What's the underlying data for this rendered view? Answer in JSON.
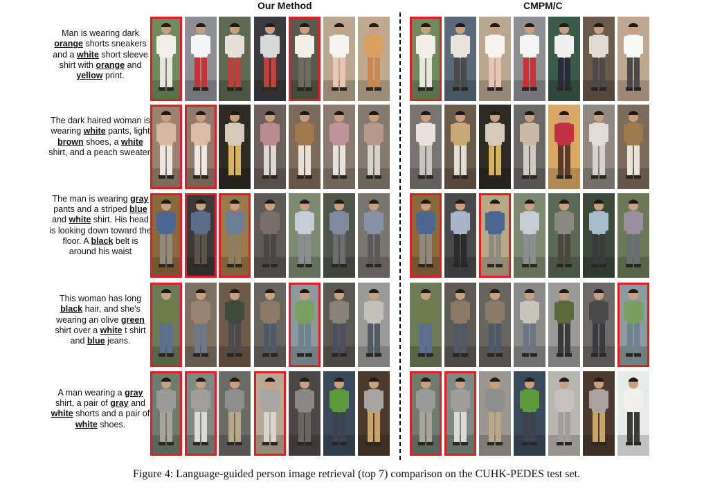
{
  "headers": {
    "left": "Our Method",
    "right": "CMPM/C"
  },
  "queries": [
    {
      "segments": [
        [
          "Man is wearing dark ",
          0
        ],
        [
          "orange",
          1
        ],
        [
          " shorts sneakers and a ",
          0
        ],
        [
          "white",
          1
        ],
        [
          " short sleeve shirt with ",
          0
        ],
        [
          "orange",
          1
        ],
        [
          " and ",
          0
        ],
        [
          "yellow",
          1
        ],
        [
          " print.",
          0
        ]
      ]
    },
    {
      "segments": [
        [
          "The dark haired woman is wearing ",
          0
        ],
        [
          "white",
          1
        ],
        [
          " pants,  light ",
          0
        ],
        [
          "brown",
          1
        ],
        [
          " shoes, a ",
          0
        ],
        [
          "white",
          1
        ],
        [
          " shirt, and a peach sweater.",
          0
        ]
      ]
    },
    {
      "segments": [
        [
          "The man is wearing ",
          0
        ],
        [
          "gray",
          1
        ],
        [
          " pants and a striped ",
          0
        ],
        [
          "blue",
          1
        ],
        [
          " and ",
          0
        ],
        [
          "white",
          1
        ],
        [
          " shirt. His head is looking down toward the floor. A ",
          0
        ],
        [
          "black",
          1
        ],
        [
          " belt is around his waist",
          0
        ]
      ]
    },
    {
      "segments": [
        [
          "This woman has long ",
          0
        ],
        [
          "black",
          1
        ],
        [
          " hair, and she's wearing an olive ",
          0
        ],
        [
          "green",
          1
        ],
        [
          " shirt over a ",
          0
        ],
        [
          "white",
          1
        ],
        [
          " t shirt and ",
          0
        ],
        [
          "blue",
          1
        ],
        [
          " jeans.",
          0
        ]
      ]
    },
    {
      "segments": [
        [
          "A man wearing a ",
          0
        ],
        [
          "gray",
          1
        ],
        [
          " shirt, a pair of ",
          0
        ],
        [
          "gray",
          1
        ],
        [
          " and ",
          0
        ],
        [
          "white",
          1
        ],
        [
          " shorts and a pair of ",
          0
        ],
        [
          "white",
          1
        ],
        [
          " shoes.",
          0
        ]
      ]
    }
  ],
  "results": {
    "ours": [
      [
        {
          "m": 1,
          "bg": "#6f8a5c",
          "top": "#f2efe8",
          "bot": "#e9e6df"
        },
        {
          "m": 0,
          "bg": "#8d8f93",
          "top": "#f5f5f5",
          "bot": "#c9313a"
        },
        {
          "m": 0,
          "bg": "#5e6a52",
          "top": "#e6e0d8",
          "bot": "#c23c3c"
        },
        {
          "m": 0,
          "bg": "#3b3b3f",
          "top": "#d8d8d8",
          "bot": "#c0403a"
        },
        {
          "m": 1,
          "bg": "#5a5a4c",
          "top": "#f3f0ea",
          "bot": "#6b6b60"
        },
        {
          "m": 0,
          "bg": "#b9a790",
          "top": "#f7f4ef",
          "bot": "#e8c6b5"
        },
        {
          "m": 0,
          "bg": "#c0ab92",
          "top": "#d9a060",
          "bot": "#c88850"
        }
      ],
      [
        {
          "m": 1,
          "bg": "#9a8470",
          "top": "#d9b8a2",
          "bot": "#ebe8e2"
        },
        {
          "m": 1,
          "bg": "#8e7b69",
          "top": "#dbbca5",
          "bot": "#ebe8e2"
        },
        {
          "m": 0,
          "bg": "#2e2a24",
          "top": "#d5c9b8",
          "bot": "#d9b25c"
        },
        {
          "m": 0,
          "bg": "#6b615a",
          "top": "#b98d8f",
          "bot": "#dcd8d2"
        },
        {
          "m": 0,
          "bg": "#7c6b5b",
          "top": "#9e7a4c",
          "bot": "#e8e3da"
        },
        {
          "m": 0,
          "bg": "#8a7a70",
          "top": "#c0929a",
          "bot": "#e6e2dc"
        },
        {
          "m": 0,
          "bg": "#857a6f",
          "top": "#b59a8a",
          "bot": "#d7d2ca"
        }
      ],
      [
        {
          "m": 1,
          "bg": "#8a6a3c",
          "top": "#4b6690",
          "bot": "#8e8a80"
        },
        {
          "m": 1,
          "bg": "#3c3a36",
          "top": "#5a6e8a",
          "bot": "#5b5448"
        },
        {
          "m": 1,
          "bg": "#9a7a4a",
          "top": "#6c7e96",
          "bot": "#8e7e62"
        },
        {
          "m": 0,
          "bg": "#5e5a55",
          "top": "#7a6e68",
          "bot": "#4a4644"
        },
        {
          "m": 0,
          "bg": "#7c8a70",
          "top": "#c5ccd6",
          "bot": "#8b8d90"
        },
        {
          "m": 0,
          "bg": "#4f5548",
          "top": "#7e8a9e",
          "bot": "#6d6d6d"
        },
        {
          "m": 0,
          "bg": "#7a7670",
          "top": "#8892a6",
          "bot": "#5a5a5a"
        }
      ],
      [
        {
          "m": 1,
          "bg": "#6c7a58",
          "top": "#6c7c4a",
          "bot": "#5a6e98"
        },
        {
          "m": 0,
          "bg": "#7d7060",
          "top": "#9a8470",
          "bot": "#6a7a8a"
        },
        {
          "m": 0,
          "bg": "#6e5a48",
          "top": "#3e4a3a",
          "bot": "#4b4a50"
        },
        {
          "m": 0,
          "bg": "#68655e",
          "top": "#8a7a66",
          "bot": "#4e5866"
        },
        {
          "m": 1,
          "bg": "#8e9aa0",
          "top": "#7aa060",
          "bot": "#6e8290"
        },
        {
          "m": 0,
          "bg": "#5a5852",
          "top": "#8a8276",
          "bot": "#4a5060"
        },
        {
          "m": 0,
          "bg": "#9a9a98",
          "top": "#c4c0ba",
          "bot": "#4e5a64"
        }
      ],
      [
        {
          "m": 1,
          "bg": "#6e7c70",
          "top": "#9a9a98",
          "bot": "#a8a49a"
        },
        {
          "m": 1,
          "bg": "#7e8a84",
          "top": "#a09e98",
          "bot": "#dcdad4"
        },
        {
          "m": 0,
          "bg": "#6c6a64",
          "top": "#8e8e8e",
          "bot": "#b8a888"
        },
        {
          "m": 1,
          "bg": "#b8a898",
          "top": "#a8a6a2",
          "bot": "#d8d4cc"
        },
        {
          "m": 0,
          "bg": "#4a4846",
          "top": "#8a8884",
          "bot": "#6a6660"
        },
        {
          "m": 0,
          "bg": "#3a4a5a",
          "top": "#5c9a3c",
          "bot": "#3e4250"
        },
        {
          "m": 0,
          "bg": "#4c3a2e",
          "top": "#a8a4a0",
          "bot": "#c8a468"
        }
      ]
    ],
    "baseline": [
      [
        {
          "m": 1,
          "bg": "#6f8a5c",
          "top": "#f2efe8",
          "bot": "#e9e6df"
        },
        {
          "m": 0,
          "bg": "#5a6a7a",
          "top": "#e8e4dc",
          "bot": "#4a4a4a"
        },
        {
          "m": 0,
          "bg": "#b9a790",
          "top": "#f7f4ef",
          "bot": "#e8c6b5"
        },
        {
          "m": 0,
          "bg": "#8d8f93",
          "top": "#f5f5f5",
          "bot": "#c9313a"
        },
        {
          "m": 0,
          "bg": "#3a5a4a",
          "top": "#f0f0f0",
          "bot": "#2a2a3a"
        },
        {
          "m": 0,
          "bg": "#6a5a4a",
          "top": "#e0dcd4",
          "bot": "#4a4a4a"
        },
        {
          "m": 0,
          "bg": "#c0a890",
          "top": "#f8f8f6",
          "bot": "#4a4a4c"
        }
      ],
      [
        {
          "m": 0,
          "bg": "#7a7470",
          "top": "#e8e2da",
          "bot": "#c8c6c0"
        },
        {
          "m": 0,
          "bg": "#6a5a4a",
          "top": "#c8a874",
          "bot": "#e0ddd6"
        },
        {
          "m": 0,
          "bg": "#2e2a24",
          "top": "#d5c9b8",
          "bot": "#d9b25c"
        },
        {
          "m": 0,
          "bg": "#6a6864",
          "top": "#c8b8a4",
          "bot": "#d0ccc4"
        },
        {
          "m": 0,
          "bg": "#d8a864",
          "top": "#c03040",
          "bot": "#5a3a2a"
        },
        {
          "m": 0,
          "bg": "#8e8880",
          "top": "#e0dcd6",
          "bot": "#d6d2cc"
        },
        {
          "m": 0,
          "bg": "#7c6b5b",
          "top": "#9e7a4c",
          "bot": "#e8e3da"
        }
      ],
      [
        {
          "m": 1,
          "bg": "#8a6a3c",
          "top": "#4b6690",
          "bot": "#8e8a80"
        },
        {
          "m": 0,
          "bg": "#4a4a4a",
          "top": "#a8b4c8",
          "bot": "#2a2a2a"
        },
        {
          "m": 1,
          "bg": "#b8a888",
          "top": "#4b6690",
          "bot": "#8e8a80"
        },
        {
          "m": 0,
          "bg": "#7c8a70",
          "top": "#c5ccd6",
          "bot": "#8b8d90"
        },
        {
          "m": 0,
          "bg": "#5a6a54",
          "top": "#8a8880",
          "bot": "#4a4640"
        },
        {
          "m": 0,
          "bg": "#3a4a38",
          "top": "#a8bcd0",
          "bot": "#3a3a3a"
        },
        {
          "m": 0,
          "bg": "#6a7a58",
          "top": "#9a8ea0",
          "bot": "#6a6e74"
        }
      ],
      [
        {
          "m": 0,
          "bg": "#6c7a58",
          "top": "#6c7c4a",
          "bot": "#5a6e98"
        },
        {
          "m": 0,
          "bg": "#5e5a54",
          "top": "#8a7a66",
          "bot": "#4e5866"
        },
        {
          "m": 0,
          "bg": "#68655e",
          "top": "#8a7a66",
          "bot": "#4e5866"
        },
        {
          "m": 0,
          "bg": "#8a8a88",
          "top": "#c8c4bc",
          "bot": "#6a7684"
        },
        {
          "m": 0,
          "bg": "#9a9a98",
          "top": "#5a6a3a",
          "bot": "#3a3a3a"
        },
        {
          "m": 0,
          "bg": "#6e6a66",
          "top": "#4a4a48",
          "bot": "#3a3a42"
        },
        {
          "m": 1,
          "bg": "#8e9aa0",
          "top": "#7aa060",
          "bot": "#6e8290"
        }
      ],
      [
        {
          "m": 1,
          "bg": "#6e7c70",
          "top": "#9a9a98",
          "bot": "#a8a49a"
        },
        {
          "m": 1,
          "bg": "#7e8a84",
          "top": "#a09e98",
          "bot": "#dcdad4"
        },
        {
          "m": 0,
          "bg": "#9a9690",
          "top": "#8e8e8e",
          "bot": "#b8a888"
        },
        {
          "m": 0,
          "bg": "#3a4a5a",
          "top": "#5c9a3c",
          "bot": "#3e4250"
        },
        {
          "m": 0,
          "bg": "#b8b6b0",
          "top": "#c4c2be",
          "bot": "#a09e98"
        },
        {
          "m": 0,
          "bg": "#4c3a2e",
          "top": "#a8a4a0",
          "bot": "#c8a468"
        },
        {
          "m": 0,
          "bg": "#e8ece8",
          "top": "#f2f0ea",
          "bot": "#3a3a38"
        }
      ]
    ]
  },
  "caption": "Figure 4: Language-guided person image retrieval (top 7) comparison on the CUHK-PEDES test set."
}
